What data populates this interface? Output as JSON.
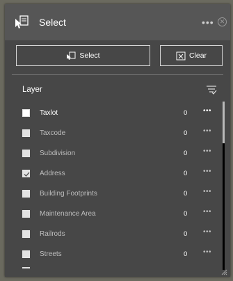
{
  "header": {
    "title": "Select",
    "more_icon": "more-dots-icon",
    "close_icon": "close-circle-icon"
  },
  "buttons": {
    "select_label": "Select",
    "clear_label": "Clear"
  },
  "layer_header": {
    "label": "Layer"
  },
  "layers": [
    {
      "name": "Taxlot",
      "count": "0",
      "checked": false,
      "active": true
    },
    {
      "name": "Taxcode",
      "count": "0",
      "checked": false,
      "active": false
    },
    {
      "name": "Subdivision",
      "count": "0",
      "checked": false,
      "active": false
    },
    {
      "name": "Address",
      "count": "0",
      "checked": true,
      "active": false
    },
    {
      "name": "Building Footprints",
      "count": "0",
      "checked": false,
      "active": false
    },
    {
      "name": "Maintenance Area",
      "count": "0",
      "checked": false,
      "active": false
    },
    {
      "name": "Railrods",
      "count": "0",
      "checked": false,
      "active": false
    },
    {
      "name": "Streets",
      "count": "0",
      "checked": false,
      "active": false
    }
  ],
  "colors": {
    "panel": "#474747",
    "header": "#565656",
    "text": "#ffffff",
    "muted": "#bdbdbd"
  }
}
